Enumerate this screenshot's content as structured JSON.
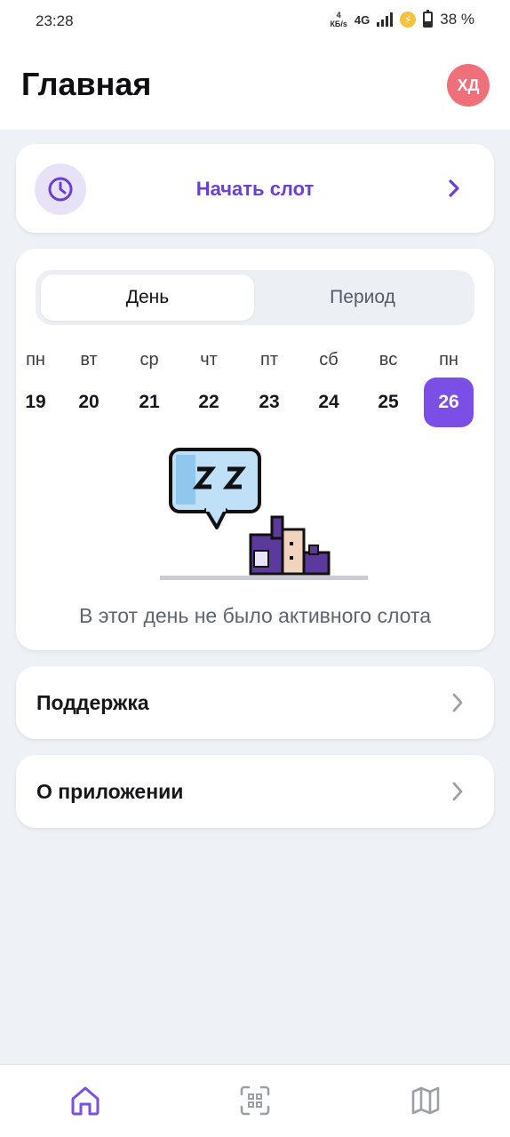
{
  "status_bar": {
    "time": "23:28",
    "speed_value": "4",
    "speed_unit": "КБ/s",
    "network": "4G",
    "battery": "38 %"
  },
  "header": {
    "title": "Главная",
    "avatar_initials": "ХД",
    "avatar_color": "#f0707a"
  },
  "slot": {
    "label": "Начать слот",
    "icon": "clock-icon",
    "accent_color": "#6c3fd4"
  },
  "calendar": {
    "tabs": [
      {
        "label": "День",
        "active": true
      },
      {
        "label": "Период",
        "active": false
      }
    ],
    "days": [
      {
        "name": "пн",
        "num": "19"
      },
      {
        "name": "вт",
        "num": "20"
      },
      {
        "name": "ср",
        "num": "21"
      },
      {
        "name": "чт",
        "num": "22"
      },
      {
        "name": "пт",
        "num": "23"
      },
      {
        "name": "сб",
        "num": "24"
      },
      {
        "name": "вс",
        "num": "25"
      },
      {
        "name": "пн",
        "num": "26",
        "selected": true
      }
    ],
    "empty_message": "В этот день не было активного слота",
    "illustration_icon": "sleeping-character-icon"
  },
  "menu": {
    "support_label": "Поддержка",
    "about_label": "О приложении"
  },
  "bottom_nav": [
    {
      "icon": "home-icon",
      "active": true
    },
    {
      "icon": "qr-scan-icon",
      "active": false
    },
    {
      "icon": "map-icon",
      "active": false
    }
  ]
}
